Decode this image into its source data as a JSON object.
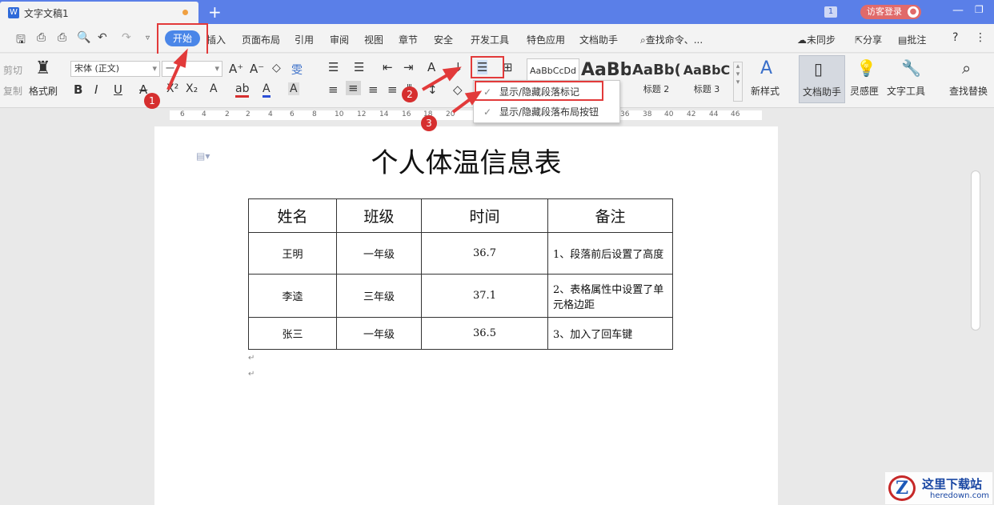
{
  "window": {
    "tab_title": "文字文稿1",
    "tab_icon": "W",
    "new_tab": "+",
    "window_count": "1",
    "login_label": "访客登录"
  },
  "menu": {
    "items": [
      "开始",
      "插入",
      "页面布局",
      "引用",
      "审阅",
      "视图",
      "章节",
      "安全",
      "开发工具",
      "特色应用",
      "文档助手"
    ],
    "search": "查找命令、...",
    "sync": "未同步",
    "share": "分享",
    "comment": "批注",
    "help": "?"
  },
  "ribbon": {
    "cut": "剪切",
    "copy": "复制",
    "format_painter": "格式刷",
    "font_name": "宋体 (正文)",
    "font_size": "一",
    "styles": [
      {
        "preview": "AaBbCcDd",
        "label": ""
      },
      {
        "preview": "AaBb",
        "label": "标题 1"
      },
      {
        "preview": "AaBb(",
        "label": "标题 2"
      },
      {
        "preview": "AaBbC",
        "label": "标题 3"
      }
    ],
    "new_style": "新样式",
    "doc_helper": "文档助手",
    "inspiration": "灵感匣",
    "text_tools": "文字工具",
    "find_replace": "查找替换"
  },
  "dropdown": {
    "items": [
      "显示/隐藏段落标记",
      "显示/隐藏段落布局按钮"
    ]
  },
  "ruler": {
    "ticks": [
      "6",
      "4",
      "2",
      "2",
      "4",
      "6",
      "8",
      "10",
      "12",
      "14",
      "16",
      "18",
      "20",
      "36",
      "38",
      "40",
      "42",
      "44",
      "46"
    ]
  },
  "document": {
    "title": "个人体温信息表",
    "table": {
      "headers": [
        "姓名",
        "班级",
        "时间",
        "备注"
      ],
      "rows": [
        [
          "王明",
          "一年级",
          "36.7",
          "1、段落前后设置了高度"
        ],
        [
          "李逵",
          "三年级",
          "37.1",
          "2、表格属性中设置了单元格边距"
        ],
        [
          "张三",
          "一年级",
          "36.5",
          "3、加入了回车键"
        ]
      ]
    }
  },
  "annotations": {
    "steps": [
      "1",
      "2",
      "3"
    ],
    "accent": "#e23a3a"
  },
  "watermark": {
    "title": "这里下载站",
    "url": "heredown.com"
  },
  "colors": {
    "titlebar": "#5a7fe8",
    "start_button": "#4a86e8",
    "login": "#e06a6a"
  }
}
